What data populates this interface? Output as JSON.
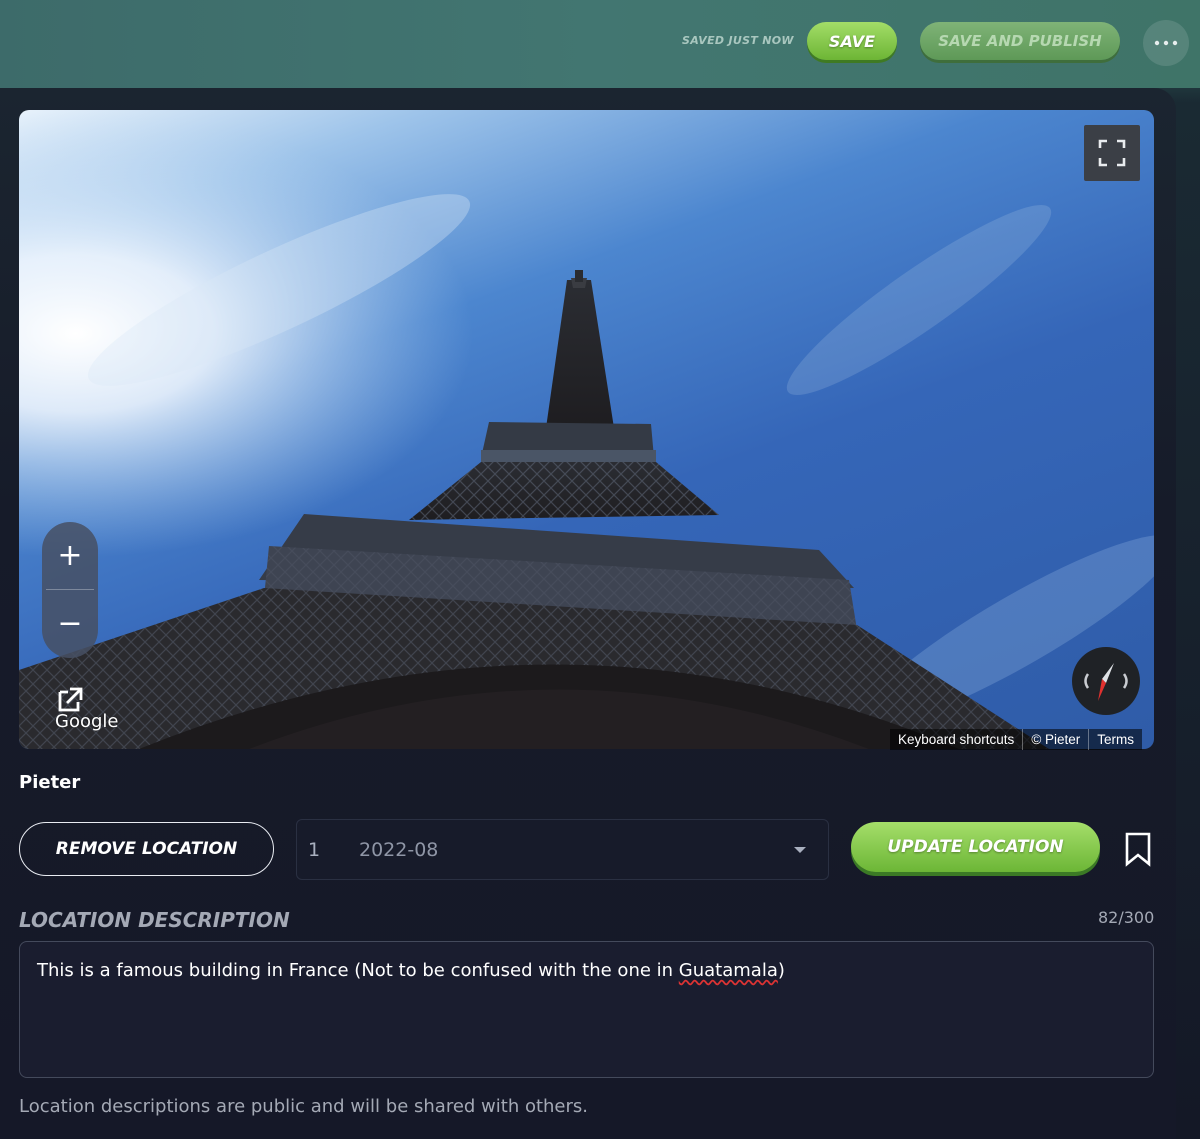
{
  "header": {
    "save_status": "SAVED JUST NOW",
    "save_label": "SAVE",
    "publish_label": "SAVE AND PUBLISH",
    "more_icon": "more-horizontal-icon"
  },
  "viewer": {
    "provider_logo": "Google",
    "attribution": {
      "shortcuts": "Keyboard shortcuts",
      "copyright": "© Pieter",
      "terms": "Terms"
    },
    "zoom_in": "+",
    "zoom_out": "−",
    "icons": [
      "fullscreen-icon",
      "external-link-icon",
      "compass-icon"
    ]
  },
  "location": {
    "owner": "Pieter",
    "remove_label": "REMOVE LOCATION",
    "panorama_index": "1",
    "panorama_date": "2022-08",
    "update_label": "UPDATE LOCATION",
    "bookmark_icon": "bookmark-icon"
  },
  "description": {
    "label": "LOCATION DESCRIPTION",
    "char_count": "82/300",
    "text_before": "This is a famous building in France (Not to be confused with the one in ",
    "text_misspelled": "Guatamala",
    "text_after": ")",
    "note": "Location descriptions are public and will be shared with others."
  },
  "colors": {
    "accent_green": "#7ac143",
    "panel_bg": "#151828",
    "header_teal": "#427671"
  }
}
